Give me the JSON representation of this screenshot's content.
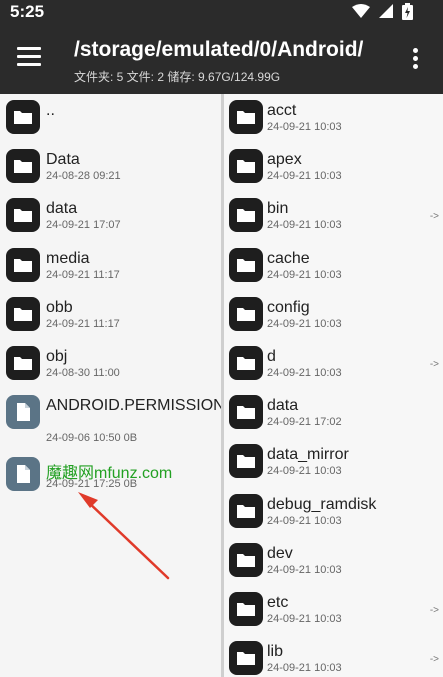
{
  "status": {
    "time": "5:25"
  },
  "appbar": {
    "path": "/storage/emulated/0/Android/",
    "info": "文件夹: 5  文件: 2  储存: 9.67G/124.99G"
  },
  "left_list": [
    {
      "name": "..",
      "meta": "",
      "type": "folder"
    },
    {
      "name": "Data",
      "meta": "24-08-28 09:21",
      "type": "folder"
    },
    {
      "name": "data",
      "meta": "24-09-21 17:07",
      "type": "folder"
    },
    {
      "name": "media",
      "meta": "24-09-21 11:17",
      "type": "folder"
    },
    {
      "name": "obb",
      "meta": "24-09-21 11:17",
      "type": "folder"
    },
    {
      "name": "obj",
      "meta": "24-08-30 11:00",
      "type": "folder"
    },
    {
      "name": "ANDROID.PERMISSION.TEST",
      "meta": "24-09-06 10:50  0B",
      "type": "file"
    },
    {
      "name": "魔趣网mfunz.com",
      "meta": "24-09-21 17:25  0B",
      "type": "file"
    }
  ],
  "right_list": [
    {
      "name": "acct",
      "meta": "24-09-21 10:03",
      "link": ""
    },
    {
      "name": "apex",
      "meta": "24-09-21 10:03",
      "link": ""
    },
    {
      "name": "bin",
      "meta": "24-09-21 10:03",
      "link": "->"
    },
    {
      "name": "cache",
      "meta": "24-09-21 10:03",
      "link": ""
    },
    {
      "name": "config",
      "meta": "24-09-21 10:03",
      "link": ""
    },
    {
      "name": "d",
      "meta": "24-09-21 10:03",
      "link": "->"
    },
    {
      "name": "data",
      "meta": "24-09-21 17:02",
      "link": ""
    },
    {
      "name": "data_mirror",
      "meta": "24-09-21 10:03",
      "link": ""
    },
    {
      "name": "debug_ramdisk",
      "meta": "24-09-21 10:03",
      "link": ""
    },
    {
      "name": "dev",
      "meta": "24-09-21 10:03",
      "link": ""
    },
    {
      "name": "etc",
      "meta": "24-09-21 10:03",
      "link": "->"
    },
    {
      "name": "lib",
      "meta": "24-09-21 10:03",
      "link": "->"
    }
  ],
  "colors": {
    "bar": "#2b2b2b",
    "folder_icon": "#1e1e1e",
    "file_icon": "#5b7486",
    "watermark": "#22a022",
    "arrow": "#e03a2a"
  }
}
